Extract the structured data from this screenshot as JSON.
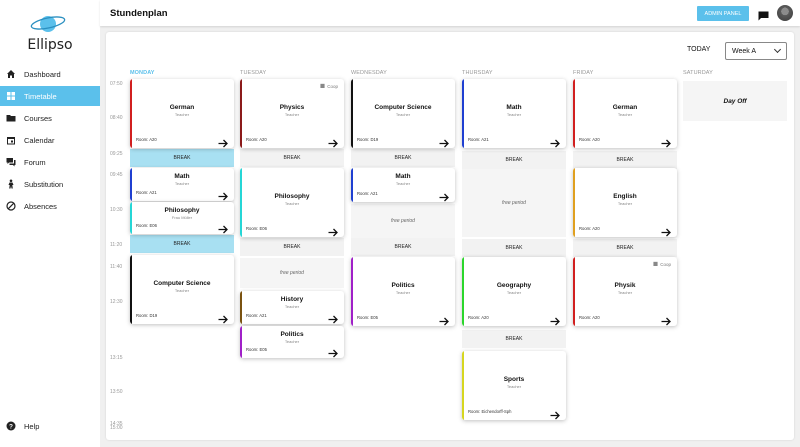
{
  "app": {
    "name": "Ellipso"
  },
  "nav": [
    {
      "label": "Dashboard",
      "icon": "home-icon"
    },
    {
      "label": "Timetable",
      "icon": "grid-icon",
      "active": true
    },
    {
      "label": "Courses",
      "icon": "folder-icon"
    },
    {
      "label": "Calendar",
      "icon": "calendar-icon"
    },
    {
      "label": "Forum",
      "icon": "chat-icon"
    },
    {
      "label": "Substitution",
      "icon": "person-icon"
    },
    {
      "label": "Absences",
      "icon": "block-icon"
    }
  ],
  "help_label": "Help",
  "header": {
    "title": "Stundenplan",
    "admin_label": "ADMIN PANEL"
  },
  "controls": {
    "today_label": "TODAY",
    "week_value": "Week A"
  },
  "days": [
    "MONDAY",
    "TUESDAY",
    "WEDNESDAY",
    "THURSDAY",
    "FRIDAY",
    "SATURDAY"
  ],
  "times": [
    "07:50",
    "08:40",
    "09:25",
    "09:45",
    "10:30",
    "11:20",
    "11:40",
    "12:30",
    "13:15",
    "13:50",
    "14:35",
    "15:00"
  ],
  "colors": {
    "accent": "#5bc0eb",
    "break_today": "#a8e0f2"
  },
  "labels": {
    "break": "BREAK",
    "free": "free period",
    "day_off": "Day Off",
    "coop": "Coop"
  },
  "lessons": [
    {
      "day": "MONDAY",
      "subject": "German",
      "teacher": "Teacher",
      "room": "Room: A20",
      "color": "#d11f1f"
    },
    {
      "day": "MONDAY",
      "subject": "Math",
      "teacher": "Teacher",
      "room": "Room: A21",
      "color": "#1f3fd1"
    },
    {
      "day": "MONDAY",
      "subject": "Philosophy",
      "teacher": "Frau Müller",
      "room": "Room: E06",
      "color": "#25d6d6"
    },
    {
      "day": "MONDAY",
      "subject": "Computer Science",
      "teacher": "Teacher",
      "room": "Room: D19",
      "color": "#111111"
    },
    {
      "day": "TUESDAY",
      "subject": "Physics",
      "teacher": "Teacher",
      "room": "Room: A20",
      "color": "#8b1a1a",
      "coop": true
    },
    {
      "day": "TUESDAY",
      "subject": "Philosophy",
      "teacher": "Teacher",
      "room": "Room: E06",
      "color": "#25d6d6"
    },
    {
      "day": "TUESDAY",
      "subject": "History",
      "teacher": "Teacher",
      "room": "Room: A21",
      "color": "#7a5210"
    },
    {
      "day": "TUESDAY",
      "subject": "Politics",
      "teacher": "Teacher",
      "room": "Room: E05",
      "color": "#a020c8"
    },
    {
      "day": "WEDNESDAY",
      "subject": "Computer Science",
      "teacher": "Teacher",
      "room": "Room: D19",
      "color": "#111111"
    },
    {
      "day": "WEDNESDAY",
      "subject": "Math",
      "teacher": "Teacher",
      "room": "Room: A21",
      "color": "#1f3fd1"
    },
    {
      "day": "WEDNESDAY",
      "subject": "Politics",
      "teacher": "Teacher",
      "room": "Room: E05",
      "color": "#a020c8"
    },
    {
      "day": "THURSDAY",
      "subject": "Math",
      "teacher": "Teacher",
      "room": "Room: A21",
      "color": "#1f3fd1"
    },
    {
      "day": "THURSDAY",
      "subject": "Geography",
      "teacher": "Teacher",
      "room": "Room: A20",
      "color": "#2bd62b"
    },
    {
      "day": "THURSDAY",
      "subject": "Sports",
      "teacher": "Teacher",
      "room": "Room: Eichendorff-Sph",
      "color": "#d6d61f"
    },
    {
      "day": "FRIDAY",
      "subject": "German",
      "teacher": "Teacher",
      "room": "Room: A20",
      "color": "#d11f1f"
    },
    {
      "day": "FRIDAY",
      "subject": "English",
      "teacher": "Teacher",
      "room": "Room: A20",
      "color": "#e0a01f"
    },
    {
      "day": "FRIDAY",
      "subject": "Physik",
      "teacher": "Teacher",
      "room": "Room: A20",
      "color": "#d11f1f",
      "coop": true
    }
  ]
}
